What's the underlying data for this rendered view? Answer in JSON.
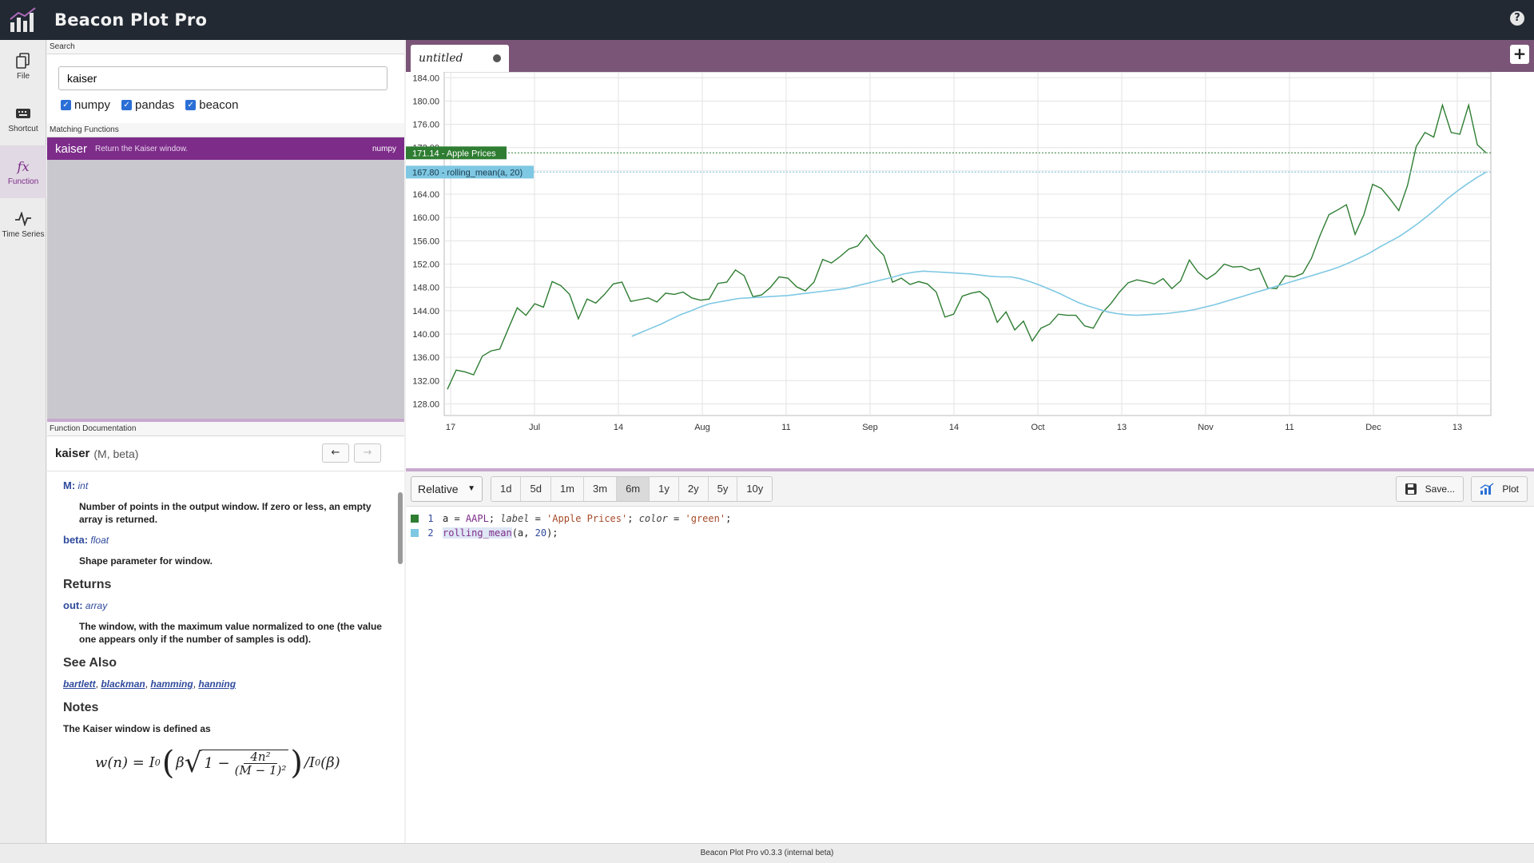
{
  "app": {
    "title": "Beacon Plot Pro",
    "help": "?",
    "logo_icon": "bar-chart-logo-icon"
  },
  "rail": [
    {
      "label": "File",
      "icon": "file-copy-icon",
      "active": false
    },
    {
      "label": "Shortcut",
      "icon": "keyboard-icon",
      "active": false
    },
    {
      "label": "Function",
      "icon": "fx-icon",
      "active": true
    },
    {
      "label": "Time Series",
      "icon": "pulse-icon",
      "active": false
    }
  ],
  "search": {
    "section": "Search",
    "value": "kaiser",
    "filters": [
      {
        "label": "numpy",
        "checked": true
      },
      {
        "label": "pandas",
        "checked": true
      },
      {
        "label": "beacon",
        "checked": true
      }
    ]
  },
  "matching": {
    "section": "Matching Functions",
    "items": [
      {
        "name": "kaiser",
        "desc": "Return the Kaiser window.",
        "lib": "numpy"
      }
    ]
  },
  "doc": {
    "section": "Function Documentation",
    "fn": "kaiser",
    "sig": "(M, beta)",
    "params": [
      {
        "name": "M:",
        "type": "int",
        "desc": "Number of points in the output window. If zero or less, an empty array is returned."
      },
      {
        "name": "beta:",
        "type": "float",
        "desc": "Shape parameter for window."
      }
    ],
    "returns_h": "Returns",
    "returns": {
      "name": "out:",
      "type": "array",
      "desc": "The window, with the maximum value normalized to one (the value one appears only if the number of samples is odd)."
    },
    "see_also_h": "See Also",
    "see_also": [
      "bartlett",
      "blackman",
      "hamming",
      "hanning"
    ],
    "notes_h": "Notes",
    "notes": "The Kaiser window is defined as"
  },
  "tab": {
    "title": "untitled"
  },
  "toolbar": {
    "mode": "Relative",
    "ranges": [
      "1d",
      "5d",
      "1m",
      "3m",
      "6m",
      "1y",
      "2y",
      "5y",
      "10y"
    ],
    "active_range": "6m",
    "save": "Save...",
    "plot": "Plot"
  },
  "editor": {
    "lines": [
      {
        "n": "1",
        "color": "#2e7d32"
      },
      {
        "n": "2",
        "color": "#7ec8e3"
      }
    ]
  },
  "status": "Beacon Plot Pro v0.3.3 (internal beta)",
  "colors": {
    "accent": "#7d2c8a",
    "series1": "#2e7d32",
    "series2": "#7ec8e3"
  },
  "chart_data": {
    "type": "line",
    "ylim": [
      126,
      185
    ],
    "yticks": [
      "128.00",
      "132.00",
      "136.00",
      "140.00",
      "144.00",
      "148.00",
      "152.00",
      "156.00",
      "160.00",
      "164.00",
      "168.00",
      "172.00",
      "176.00",
      "180.00",
      "184.00"
    ],
    "xticks": [
      "17",
      "Jul",
      "14",
      "Aug",
      "11",
      "Sep",
      "14",
      "Oct",
      "13",
      "Nov",
      "11",
      "Dec",
      "13"
    ],
    "series": [
      {
        "name": "Apple Prices",
        "last_label": "171.14",
        "color": "#2e7d32",
        "values": [
          130.5,
          133.8,
          133.5,
          133.0,
          136.2,
          137.1,
          137.4,
          141.0,
          144.5,
          143.2,
          145.2,
          144.6,
          149.0,
          148.3,
          146.8,
          142.6,
          146.0,
          145.3,
          146.8,
          148.6,
          148.9,
          145.6,
          145.9,
          146.2,
          145.5,
          147.0,
          146.8,
          147.2,
          146.2,
          145.8,
          146.0,
          148.7,
          148.9,
          151.0,
          150.0,
          146.4,
          146.7,
          148.0,
          149.8,
          149.6,
          148.1,
          147.4,
          148.9,
          152.8,
          152.2,
          153.3,
          154.6,
          155.1,
          157.0,
          155.0,
          153.5,
          148.9,
          149.6,
          148.5,
          149.0,
          148.6,
          147.2,
          142.9,
          143.4,
          146.5,
          147.0,
          147.3,
          146.0,
          142.0,
          143.8,
          140.7,
          142.2,
          138.8,
          141.0,
          141.7,
          143.4,
          143.2,
          143.2,
          141.4,
          141.0,
          143.6,
          145.2,
          147.2,
          148.8,
          149.3,
          149.0,
          148.6,
          149.5,
          147.8,
          149.1,
          152.7,
          150.6,
          149.4,
          150.4,
          152.0,
          151.5,
          151.6,
          150.9,
          151.3,
          147.9,
          147.8,
          150.0,
          149.8,
          150.4,
          153.0,
          157.0,
          160.5,
          161.3,
          162.2,
          157.1,
          160.5,
          165.7,
          165.0,
          163.2,
          161.2,
          165.5,
          172.2,
          174.6,
          173.8,
          179.3,
          174.6,
          174.3,
          179.3,
          172.5,
          171.1
        ]
      },
      {
        "name": "rolling_mean(a, 20)",
        "last_label": "167.80",
        "color": "#7ec8e3",
        "values": [
          null,
          null,
          null,
          null,
          null,
          null,
          null,
          null,
          null,
          null,
          null,
          null,
          null,
          null,
          null,
          null,
          null,
          null,
          null,
          139.6,
          140.3,
          141.0,
          141.7,
          142.5,
          143.3,
          143.9,
          144.6,
          145.2,
          145.5,
          145.8,
          146.1,
          146.2,
          146.3,
          146.4,
          146.5,
          146.6,
          146.8,
          147.0,
          147.2,
          147.4,
          147.6,
          147.8,
          148.2,
          148.6,
          149.0,
          149.4,
          149.8,
          150.3,
          150.6,
          150.8,
          150.7,
          150.6,
          150.5,
          150.4,
          150.3,
          150.1,
          149.9,
          149.8,
          149.8,
          149.5,
          149.0,
          148.4,
          147.7,
          147.0,
          146.2,
          145.4,
          144.8,
          144.3,
          143.8,
          143.5,
          143.3,
          143.2,
          143.3,
          143.4,
          143.5,
          143.7,
          143.9,
          144.2,
          144.6,
          145.0,
          145.5,
          146.0,
          146.5,
          147.0,
          147.5,
          148.0,
          148.5,
          149.0,
          149.5,
          150.0,
          150.5,
          151.0,
          151.6,
          152.3,
          153.1,
          153.9,
          154.9,
          155.8,
          156.7,
          157.8,
          159.0,
          160.3,
          161.7,
          163.2,
          164.5,
          165.7,
          166.8,
          167.8
        ]
      }
    ]
  }
}
